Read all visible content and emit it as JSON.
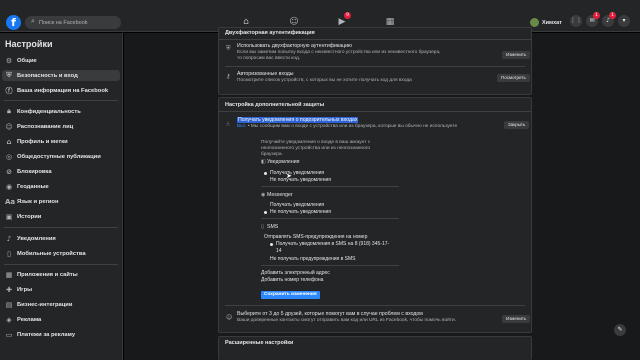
{
  "topbar": {
    "search_placeholder": "Поиск на Facebook",
    "profile_name": "Химхат",
    "badges": {
      "watch": "9",
      "messenger": "1",
      "notifications": "1"
    }
  },
  "sidebar": {
    "title": "Настройки",
    "items": [
      {
        "label": "Общие",
        "icon": "gear-icon"
      },
      {
        "label": "Безопасность и вход",
        "icon": "shield-icon"
      },
      {
        "label": "Ваша информация на Facebook",
        "icon": "facebook-icon"
      },
      {
        "label": "Конфиденциальность",
        "icon": "lock-icon"
      },
      {
        "label": "Распознавание лиц",
        "icon": "face-icon"
      },
      {
        "label": "Профиль и метки",
        "icon": "tag-icon"
      },
      {
        "label": "Общедоступные публикации",
        "icon": "globe-icon"
      },
      {
        "label": "Блокировка",
        "icon": "block-icon"
      },
      {
        "label": "Геоданные",
        "icon": "location-icon"
      },
      {
        "label": "Язык и регион",
        "icon": "language-icon"
      },
      {
        "label": "Истории",
        "icon": "stories-icon"
      },
      {
        "label": "Уведомления",
        "icon": "bell-icon"
      },
      {
        "label": "Мобильные устройства",
        "icon": "mobile-icon"
      },
      {
        "label": "Приложения и сайты",
        "icon": "apps-icon"
      },
      {
        "label": "Игры",
        "icon": "game-icon"
      },
      {
        "label": "Бизнес-интеграции",
        "icon": "business-icon"
      },
      {
        "label": "Реклама",
        "icon": "ads-icon"
      },
      {
        "label": "Платежи за рекламу",
        "icon": "payment-icon"
      }
    ]
  },
  "content": {
    "top_section_title": "Двухфакторная аутентификация",
    "two_factor": {
      "title": "Использовать двухфакторную аутентификацию",
      "sub1": "Если мы заметим попытку входа с неизвестного устройства или из неизвестного браузера,",
      "sub2": "то попросим вас ввести код.",
      "button": "Изменить"
    },
    "authorized": {
      "title": "Авторизованные входы",
      "sub": "Посмотрите список устройств, с которых вы не хотите получать код для входа",
      "button": "Посмотреть"
    },
    "extra_section_title": "Настройка дополнительной защиты",
    "alerts": {
      "title": "Получать уведомления о подозрительных входах",
      "status": "Вкл.",
      "desc": " • Мы сообщим вам о входе с устройства или из браузера, которые вы обычно не используете",
      "button": "Закрыть",
      "explain1": "Получайте уведомления о входе в ваш аккаунт с",
      "explain2": "неопознанного устройства или из неопознанного",
      "explain3": "браузера.",
      "notif_head": "Уведомления",
      "notif_on": "Получать уведомления",
      "notif_off": "Не получать уведомления",
      "msgr_head": "Messenger",
      "msgr_on": "Получать уведомления",
      "msgr_off": "Не получать уведомления",
      "sms_head": "SMS",
      "sms_opt1": "Отправлять SMS-предупреждения на номер",
      "sms_opt2": "Получать уведомления в SMS на 8 (918) 345-17-",
      "sms_opt2b": "14",
      "sms_off": "Не получать предупреждения в SMS",
      "add_email": "Добавить электронный адрес",
      "add_phone": "Добавить номер телефона",
      "save": "Сохранить изменения"
    },
    "trusted": {
      "title": "Выберите от 3 до 5 друзей, которые помогут вам в случае проблем с входом",
      "sub": "Ваши доверенные контакты смогут отправить вам код или URL из Facebook, чтобы помочь войти.",
      "button": "Изменить"
    },
    "advanced_title": "Расширенные настройки"
  }
}
